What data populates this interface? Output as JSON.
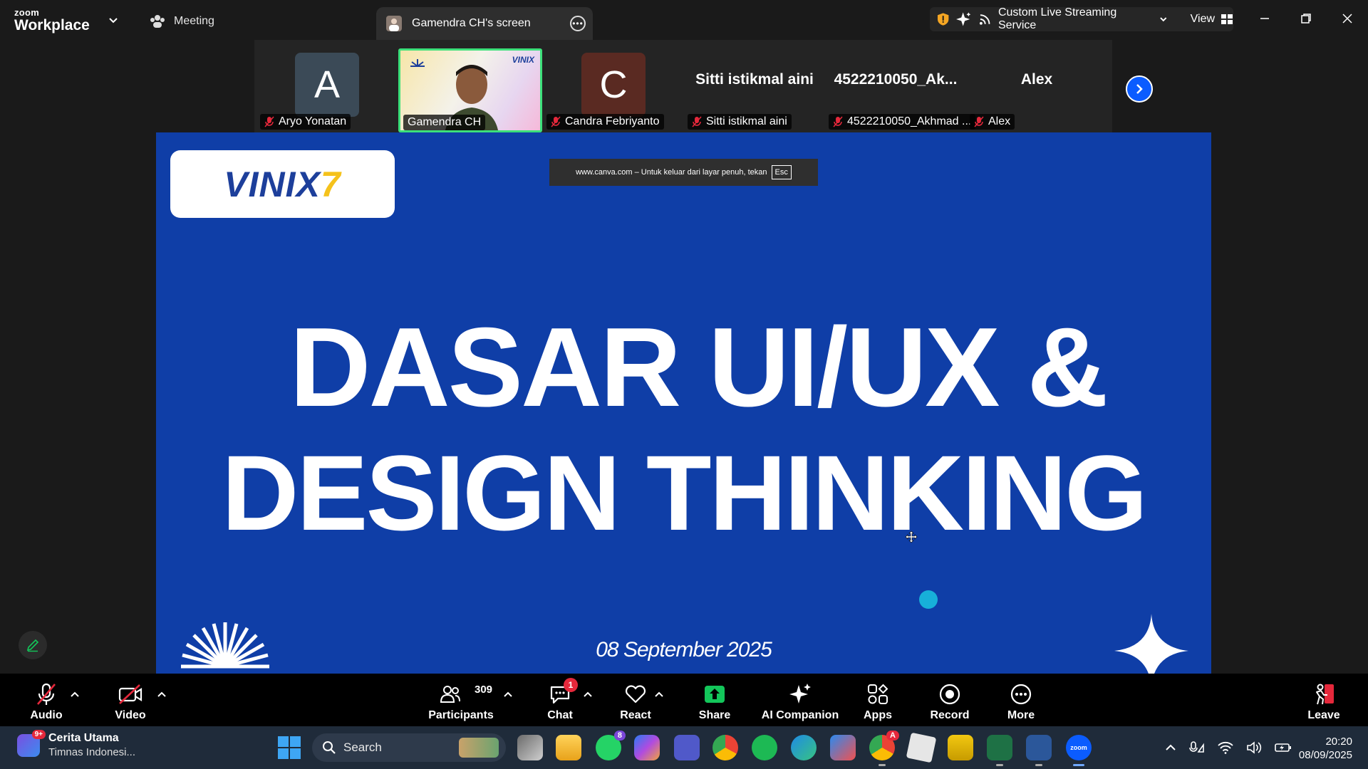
{
  "titlebar": {
    "brand_top": "zoom",
    "brand_bottom": "Workplace",
    "meeting_label": "Meeting",
    "screen_tab_label": "Gamendra CH's screen",
    "streaming_label": "Custom Live Streaming Service",
    "view_label": "View"
  },
  "gallery": {
    "tiles": [
      {
        "initial": "A",
        "name": "Aryo Yonatan",
        "avatar_color": "#3b4a57"
      },
      {
        "name": "Gamendra CH",
        "video_logo": "VINIX"
      },
      {
        "initial": "C",
        "name": "Candra Febriyanto",
        "avatar_color": "#5a2a22"
      },
      {
        "display_name": "Sitti istikmal aini",
        "name": "Sitti istikmal aini"
      },
      {
        "display_name": "4522210050_Ak...",
        "name": "4522210050_Akhmad ..."
      },
      {
        "display_name": "Alex",
        "name": "Alex"
      }
    ]
  },
  "slide": {
    "logo": "VINIX",
    "logo_seven": "7",
    "fullscreen_notice": "www.canva.com – Untuk keluar dari layar penuh, tekan",
    "esc_key": "Esc",
    "title_line1": "DASAR UI/UX &",
    "title_line2": "DESIGN THINKING",
    "date": "08 September 2025",
    "background_color": "#0f3ea7",
    "accent_dot_color": "#17b0d9"
  },
  "toolbar": {
    "audio": "Audio",
    "video": "Video",
    "participants": "Participants",
    "participants_count": "309",
    "chat": "Chat",
    "chat_badge": "1",
    "react": "React",
    "share": "Share",
    "ai_companion": "AI Companion",
    "apps": "Apps",
    "record": "Record",
    "more": "More",
    "leave": "Leave",
    "share_color": "#13c65a",
    "leave_color": "#e5283b"
  },
  "taskbar": {
    "news_badge": "9+",
    "news_title": "Cerita Utama",
    "news_subtitle": "Timnas Indonesi...",
    "search_label": "Search",
    "whatsapp_badge": "8",
    "chrome_badge": "A",
    "zoom_label": "zoom",
    "time": "20:20",
    "date": "08/09/2025"
  }
}
